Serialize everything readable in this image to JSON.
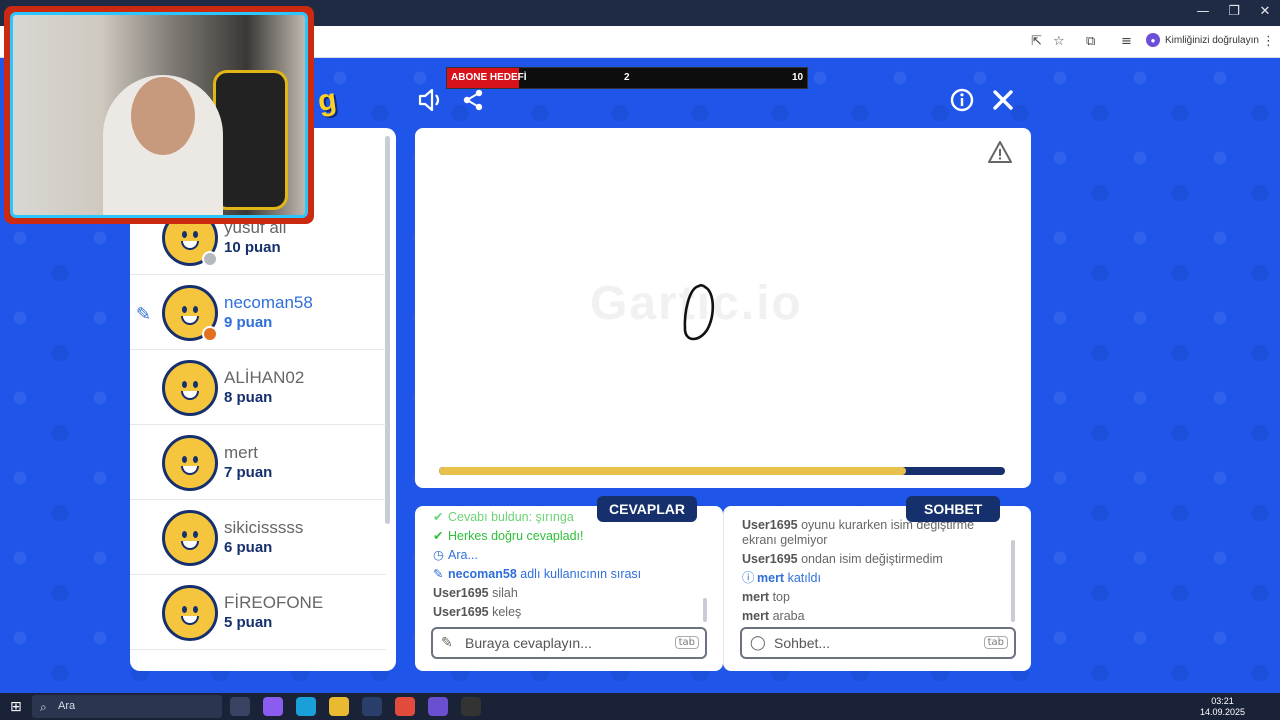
{
  "browser": {
    "verify_label": "Kimliğinizi doğrulayın",
    "window_controls": [
      "—",
      "❐",
      "✕"
    ]
  },
  "stream_overlay": {
    "goal_label": "ABONE HEDEFİ",
    "goal_current": "2",
    "goal_target": "10",
    "goal_progress": 0.2
  },
  "game": {
    "logo_fragment": "g",
    "watermark": "Gartic.io",
    "timer_progress": 0.825,
    "players": [
      {
        "name": "yusuf ali",
        "points": "10 puan",
        "status_color": "#b5b8be",
        "active": false
      },
      {
        "name": "necoman58",
        "points": "9 puan",
        "status_color": "#e2701c",
        "active": true
      },
      {
        "name": "ALİHAN02",
        "points": "8 puan",
        "status_color": "",
        "active": false
      },
      {
        "name": "mert",
        "points": "7 puan",
        "status_color": "",
        "active": false
      },
      {
        "name": "sikicisssss",
        "points": "6 puan",
        "status_color": "",
        "active": false
      },
      {
        "name": "FİREOFONE",
        "points": "5 puan",
        "status_color": "",
        "active": false
      }
    ],
    "answers": {
      "title": "CEVAPLAR",
      "placeholder": "Buraya cevaplayın...",
      "tab_hint": "tab",
      "messages": [
        {
          "type": "green",
          "text": "Cevabı buldun: şırınga"
        },
        {
          "type": "green",
          "text": "Herkes doğru cevapladı!"
        },
        {
          "type": "blue",
          "text": "Ara..."
        },
        {
          "type": "blue-user",
          "user": "necoman58",
          "text": "adlı kullanıcının sırası"
        },
        {
          "type": "user",
          "user": "User1695",
          "text": "silah"
        },
        {
          "type": "user",
          "user": "User1695",
          "text": "keleş"
        }
      ]
    },
    "chat": {
      "title": "SOHBET",
      "placeholder": "Sohbet...",
      "tab_hint": "tab",
      "messages": [
        {
          "type": "user",
          "user": "User1695",
          "text": "oyunu kurarken isim değiştirme ekranı gelmiyor"
        },
        {
          "type": "user",
          "user": "User1695",
          "text": "ondan isim değiştirmedim"
        },
        {
          "type": "blue-user",
          "user": "mert",
          "text": "katıldı"
        },
        {
          "type": "user",
          "user": "mert",
          "text": "top"
        },
        {
          "type": "user",
          "user": "mert",
          "text": "araba"
        }
      ]
    }
  },
  "taskbar": {
    "search_label": "Ara",
    "time": "03:21",
    "date": "14.09.2025"
  },
  "colors": {
    "game_bg": "#1f55e8",
    "navy": "#16306e",
    "accent_blue": "#2f6fd9",
    "green": "#2fbf3a",
    "goal_red": "#d8121b",
    "timer_yellow": "#e8c14d"
  }
}
